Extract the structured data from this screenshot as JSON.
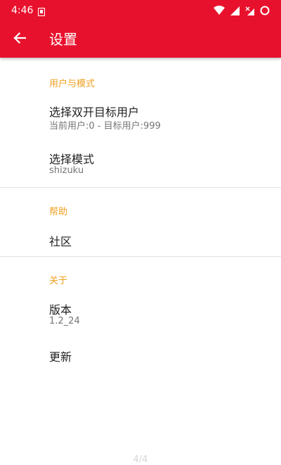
{
  "status_bar": {
    "time": "4:46"
  },
  "app_bar": {
    "title": "设置"
  },
  "sections": [
    {
      "category": "用户与模式",
      "items": [
        {
          "title": "选择双开目标用户",
          "summary": "当前用户:0 - 目标用户:999"
        },
        {
          "title": "选择模式",
          "summary": "shizuku"
        }
      ]
    },
    {
      "category": "帮助",
      "items": [
        {
          "title": "社区"
        }
      ]
    },
    {
      "category": "关于",
      "items": [
        {
          "title": "版本",
          "summary": "1.2_24"
        },
        {
          "title": "更新"
        }
      ]
    }
  ],
  "page_indicator": "4/4",
  "colors": {
    "primary": "#e8112d",
    "accent": "#f0a020"
  }
}
